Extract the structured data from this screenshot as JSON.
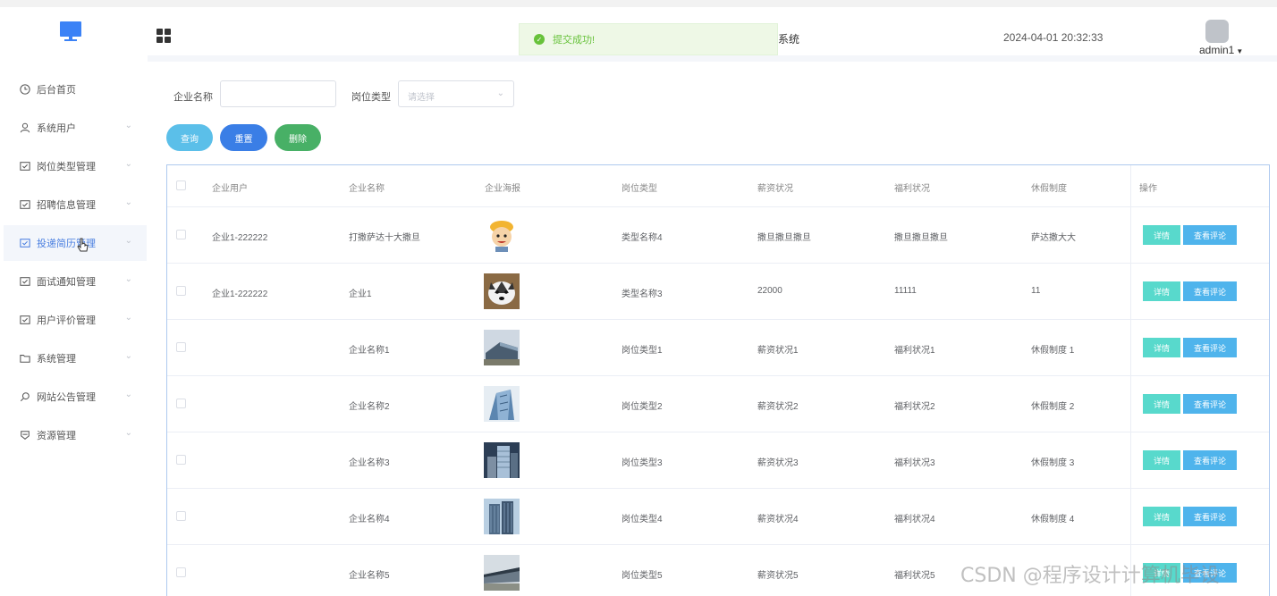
{
  "header": {
    "system_title_partial": "系统",
    "datetime": "2024-04-01 20:32:33",
    "username": "admin1",
    "toast": "提交成功!"
  },
  "sidebar": {
    "items": [
      {
        "label": "后台首页",
        "icon": "clock-icon",
        "chevron": false,
        "active": false
      },
      {
        "label": "系统用户",
        "icon": "user-icon",
        "chevron": true,
        "active": false
      },
      {
        "label": "岗位类型管理",
        "icon": "form-icon",
        "chevron": true,
        "active": false
      },
      {
        "label": "招聘信息管理",
        "icon": "form-icon",
        "chevron": true,
        "active": false
      },
      {
        "label": "投递简历管理",
        "icon": "form-icon",
        "chevron": true,
        "active": true
      },
      {
        "label": "面试通知管理",
        "icon": "form-icon",
        "chevron": true,
        "active": false
      },
      {
        "label": "用户评价管理",
        "icon": "form-icon",
        "chevron": true,
        "active": false
      },
      {
        "label": "系统管理",
        "icon": "folder-icon",
        "chevron": true,
        "active": false
      },
      {
        "label": "网站公告管理",
        "icon": "search-icon",
        "chevron": true,
        "active": false
      },
      {
        "label": "资源管理",
        "icon": "shield-icon",
        "chevron": true,
        "active": false
      }
    ]
  },
  "filters": {
    "company_label": "企业名称",
    "company_value": "",
    "job_type_label": "岗位类型",
    "job_type_placeholder": "请选择"
  },
  "buttons": {
    "query": "查询",
    "reset": "重置",
    "delete": "删除"
  },
  "table": {
    "headers": [
      "企业用户",
      "企业名称",
      "企业海报",
      "岗位类型",
      "薪资状况",
      "福利状况",
      "休假制度",
      "操作"
    ],
    "op_detail": "详情",
    "op_review": "查看评论",
    "rows": [
      {
        "user": "企业1-222222",
        "name": "打撒萨达十大撒旦",
        "poster": "cartoon-face",
        "type": "类型名称4",
        "salary": "撒旦撒旦撒旦",
        "welfare": "撒旦撒旦撒旦",
        "vacation": "萨达撒大大"
      },
      {
        "user": "企业1-222222",
        "name": "企业1",
        "poster": "husky-dog",
        "type": "类型名称3",
        "salary": "22000",
        "welfare": "11111",
        "vacation": "11"
      },
      {
        "user": "",
        "name": "企业名称1",
        "poster": "building-a",
        "type": "岗位类型1",
        "salary": "薪资状况1",
        "welfare": "福利状况1",
        "vacation": "休假制度 1"
      },
      {
        "user": "",
        "name": "企业名称2",
        "poster": "building-b",
        "type": "岗位类型2",
        "salary": "薪资状况2",
        "welfare": "福利状况2",
        "vacation": "休假制度 2"
      },
      {
        "user": "",
        "name": "企业名称3",
        "poster": "building-c",
        "type": "岗位类型3",
        "salary": "薪资状况3",
        "welfare": "福利状况3",
        "vacation": "休假制度 3"
      },
      {
        "user": "",
        "name": "企业名称4",
        "poster": "building-d",
        "type": "岗位类型4",
        "salary": "薪资状况4",
        "welfare": "福利状况4",
        "vacation": "休假制度 4"
      },
      {
        "user": "",
        "name": "企业名称5",
        "poster": "building-e",
        "type": "岗位类型5",
        "salary": "薪资状况5",
        "welfare": "福利状况5",
        "vacation": ""
      }
    ]
  },
  "watermark": "CSDN @程序设计计算机毕设",
  "colors": {
    "query": "#5bbfe9",
    "reset": "#3a7ee6",
    "delete": "#48b066",
    "detail": "#58d9cc",
    "review": "#4fb4ec",
    "active_menu": "#4a7fe0"
  }
}
